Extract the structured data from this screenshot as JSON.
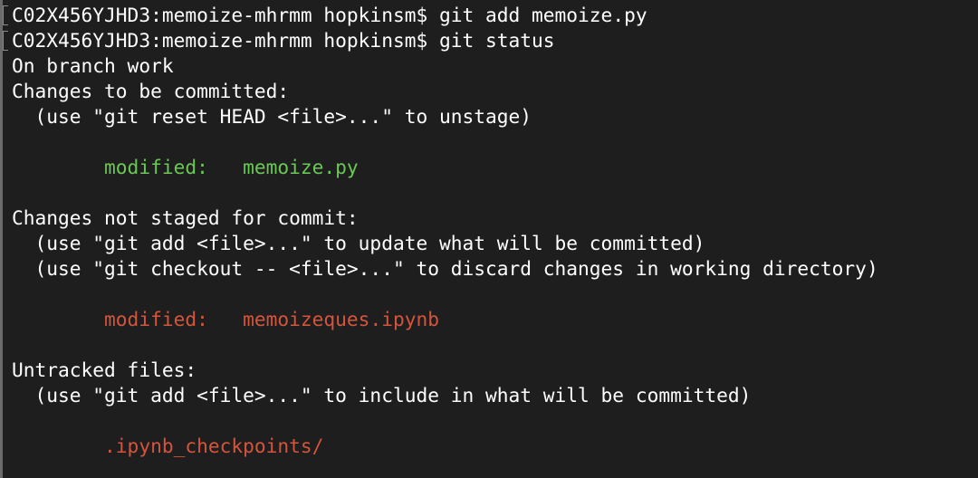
{
  "terminal": {
    "prompt_1": "C02X456YJHD3:memoize-mhrmm hopkinsm$",
    "command_1": " git add memoize.py",
    "prompt_2": "C02X456YJHD3:memoize-mhrmm hopkinsm$",
    "command_2": " git status",
    "branch_line": "On branch work",
    "staged_header": "Changes to be committed:",
    "staged_hint": "  (use \"git reset HEAD <file>...\" to unstage)",
    "staged_files": [
      {
        "status": "        modified:   ",
        "name": "memoize.py"
      }
    ],
    "unstaged_header": "Changes not staged for commit:",
    "unstaged_hint_1": "  (use \"git add <file>...\" to update what will be committed)",
    "unstaged_hint_2": "  (use \"git checkout -- <file>...\" to discard changes in working directory)",
    "unstaged_files": [
      {
        "status": "        modified:   ",
        "name": "memoizeques.ipynb"
      }
    ],
    "untracked_header": "Untracked files:",
    "untracked_hint": "  (use \"git add <file>...\" to include in what will be committed)",
    "untracked_files": [
      {
        "name": "        .ipynb_checkpoints/"
      }
    ]
  },
  "colors": {
    "background": "#1e1e1e",
    "text": "#ffffff",
    "staged": "#6ac855",
    "unstaged": "#d4553d"
  }
}
